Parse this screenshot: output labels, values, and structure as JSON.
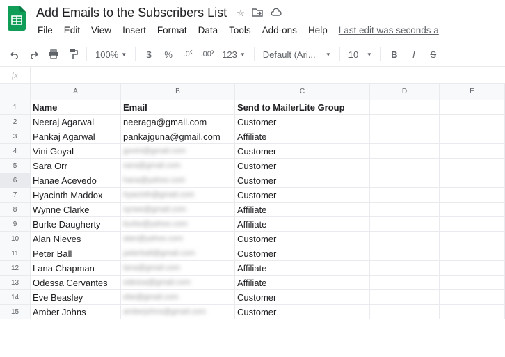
{
  "doc": {
    "title": "Add Emails to the Subscribers List"
  },
  "menu": {
    "file": "File",
    "edit": "Edit",
    "view": "View",
    "insert": "Insert",
    "format": "Format",
    "data": "Data",
    "tools": "Tools",
    "addons": "Add-ons",
    "help": "Help",
    "lastEdit": "Last edit was seconds a"
  },
  "toolbar": {
    "zoom": "100%",
    "dollar": "$",
    "percent": "%",
    "numFmt": "123",
    "font": "Default (Ari...",
    "fontSize": "10",
    "bold": "B",
    "italic": "I",
    "strike": "S"
  },
  "fx": {
    "label": "fx"
  },
  "columns": [
    "A",
    "B",
    "C",
    "D",
    "E"
  ],
  "headerRow": {
    "name": "Name",
    "email": "Email",
    "group": "Send to MailerLite Group"
  },
  "selectedRow": 6,
  "rows": [
    {
      "n": 1,
      "name": "Name",
      "email": "Email",
      "group": "Send to MailerLite Group",
      "isHeader": true
    },
    {
      "n": 2,
      "name": "Neeraj Agarwal",
      "email": "neeraga@gmail.com",
      "group": "Customer"
    },
    {
      "n": 3,
      "name": "Pankaj Agarwal",
      "email": "pankajguna@gmail.com",
      "group": "Affiliate"
    },
    {
      "n": 4,
      "name": "Vini Goyal",
      "email": "govini@gmail.com",
      "group": "Customer",
      "blur": true
    },
    {
      "n": 5,
      "name": "Sara Orr",
      "email": "sara@gmail.com",
      "group": "Customer",
      "blur": true
    },
    {
      "n": 6,
      "name": "Hanae Acevedo",
      "email": "hana@yahoo.com",
      "group": "Customer",
      "blur": true
    },
    {
      "n": 7,
      "name": "Hyacinth Maddox",
      "email": "hyacinth@gmail.com",
      "group": "Customer",
      "blur": true
    },
    {
      "n": 8,
      "name": "Wynne Clarke",
      "email": "synee@gmail.com",
      "group": "Affiliate",
      "blur": true
    },
    {
      "n": 9,
      "name": "Burke Daugherty",
      "email": "burke@yahoo.com",
      "group": "Affiliate",
      "blur": true
    },
    {
      "n": 10,
      "name": "Alan Nieves",
      "email": "alan@yahoo.com",
      "group": "Customer",
      "blur": true
    },
    {
      "n": 11,
      "name": "Peter Ball",
      "email": "peterball@gmail.com",
      "group": "Customer",
      "blur": true
    },
    {
      "n": 12,
      "name": "Lana Chapman",
      "email": "lana@gmail.com",
      "group": "Affiliate",
      "blur": true
    },
    {
      "n": 13,
      "name": "Odessa Cervantes",
      "email": "odessa@gmail.com",
      "group": "Affiliate",
      "blur": true
    },
    {
      "n": 14,
      "name": "Eve Beasley",
      "email": "ebe@gmail.com",
      "group": "Customer",
      "blur": true
    },
    {
      "n": 15,
      "name": "Amber Johns",
      "email": "amberjohns@gmail.com",
      "group": "Customer",
      "blur": true
    }
  ]
}
